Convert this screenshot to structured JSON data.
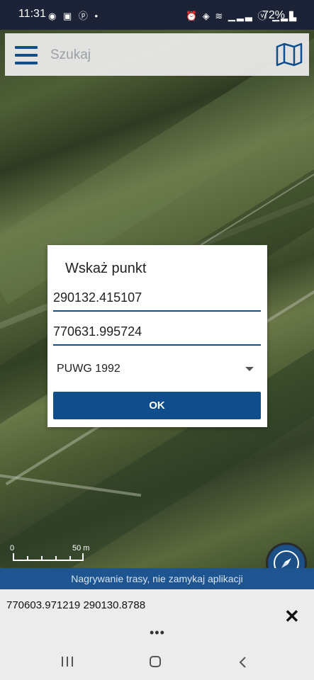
{
  "status_bar": {
    "time": "11:31",
    "left_icons": [
      "notification-app-icon",
      "image-icon",
      "pinterest-icon",
      "dot-icon"
    ],
    "right_icons": [
      "alarm-icon",
      "location-icon",
      "wifi-icon",
      "signal-icon",
      "volte-icon",
      "signal-icon"
    ],
    "battery": "72%"
  },
  "search": {
    "placeholder": "Szukaj"
  },
  "dialog": {
    "title": "Wskaż punkt",
    "field_1": "290132.415107",
    "field_2": "770631.995724",
    "crs_select": "PUWG 1992",
    "ok_label": "OK"
  },
  "scale": {
    "start": "0",
    "end": "50 m"
  },
  "recording_banner": "Nagrywanie trasy, nie zamykaj aplikacji",
  "coordinates": "770603.971219 290130.8788",
  "more_dots": "•••",
  "colors": {
    "accent": "#0f4d8c",
    "banner": "#1e5490",
    "status_bar": "#1d2336"
  }
}
